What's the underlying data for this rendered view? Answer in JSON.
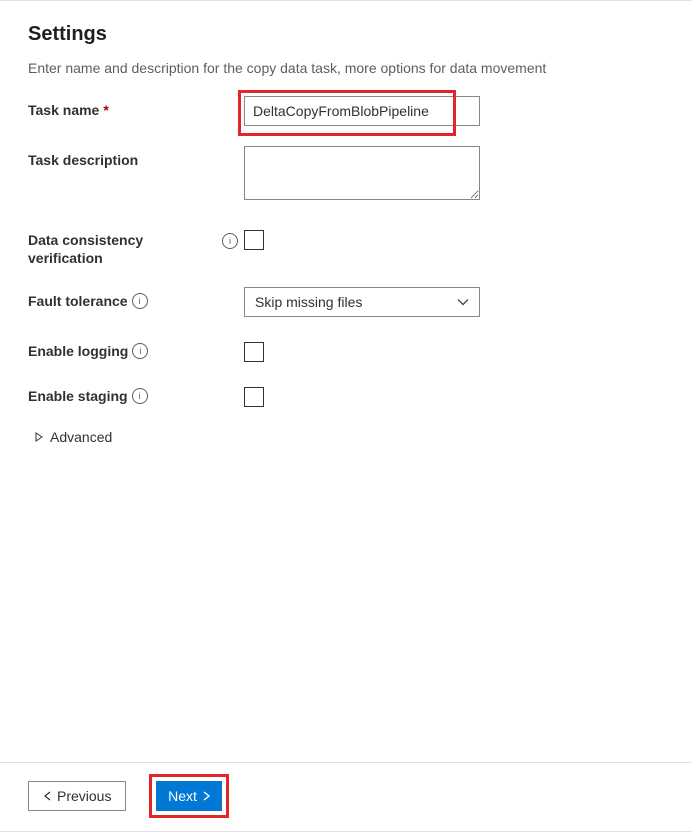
{
  "page": {
    "title": "Settings",
    "description": "Enter name and description for the copy data task, more options for data movement"
  },
  "fields": {
    "task_name": {
      "label": "Task name",
      "value": "DeltaCopyFromBlobPipeline",
      "required_marker": "*"
    },
    "task_description": {
      "label": "Task description",
      "value": ""
    },
    "data_consistency": {
      "label_line1": "Data consistency",
      "label_line2": "verification",
      "checked": false
    },
    "fault_tolerance": {
      "label": "Fault tolerance",
      "selected": "Skip missing files"
    },
    "enable_logging": {
      "label": "Enable logging",
      "checked": false
    },
    "enable_staging": {
      "label": "Enable staging",
      "checked": false
    },
    "advanced": {
      "label": "Advanced"
    }
  },
  "footer": {
    "previous": "Previous",
    "next": "Next"
  }
}
